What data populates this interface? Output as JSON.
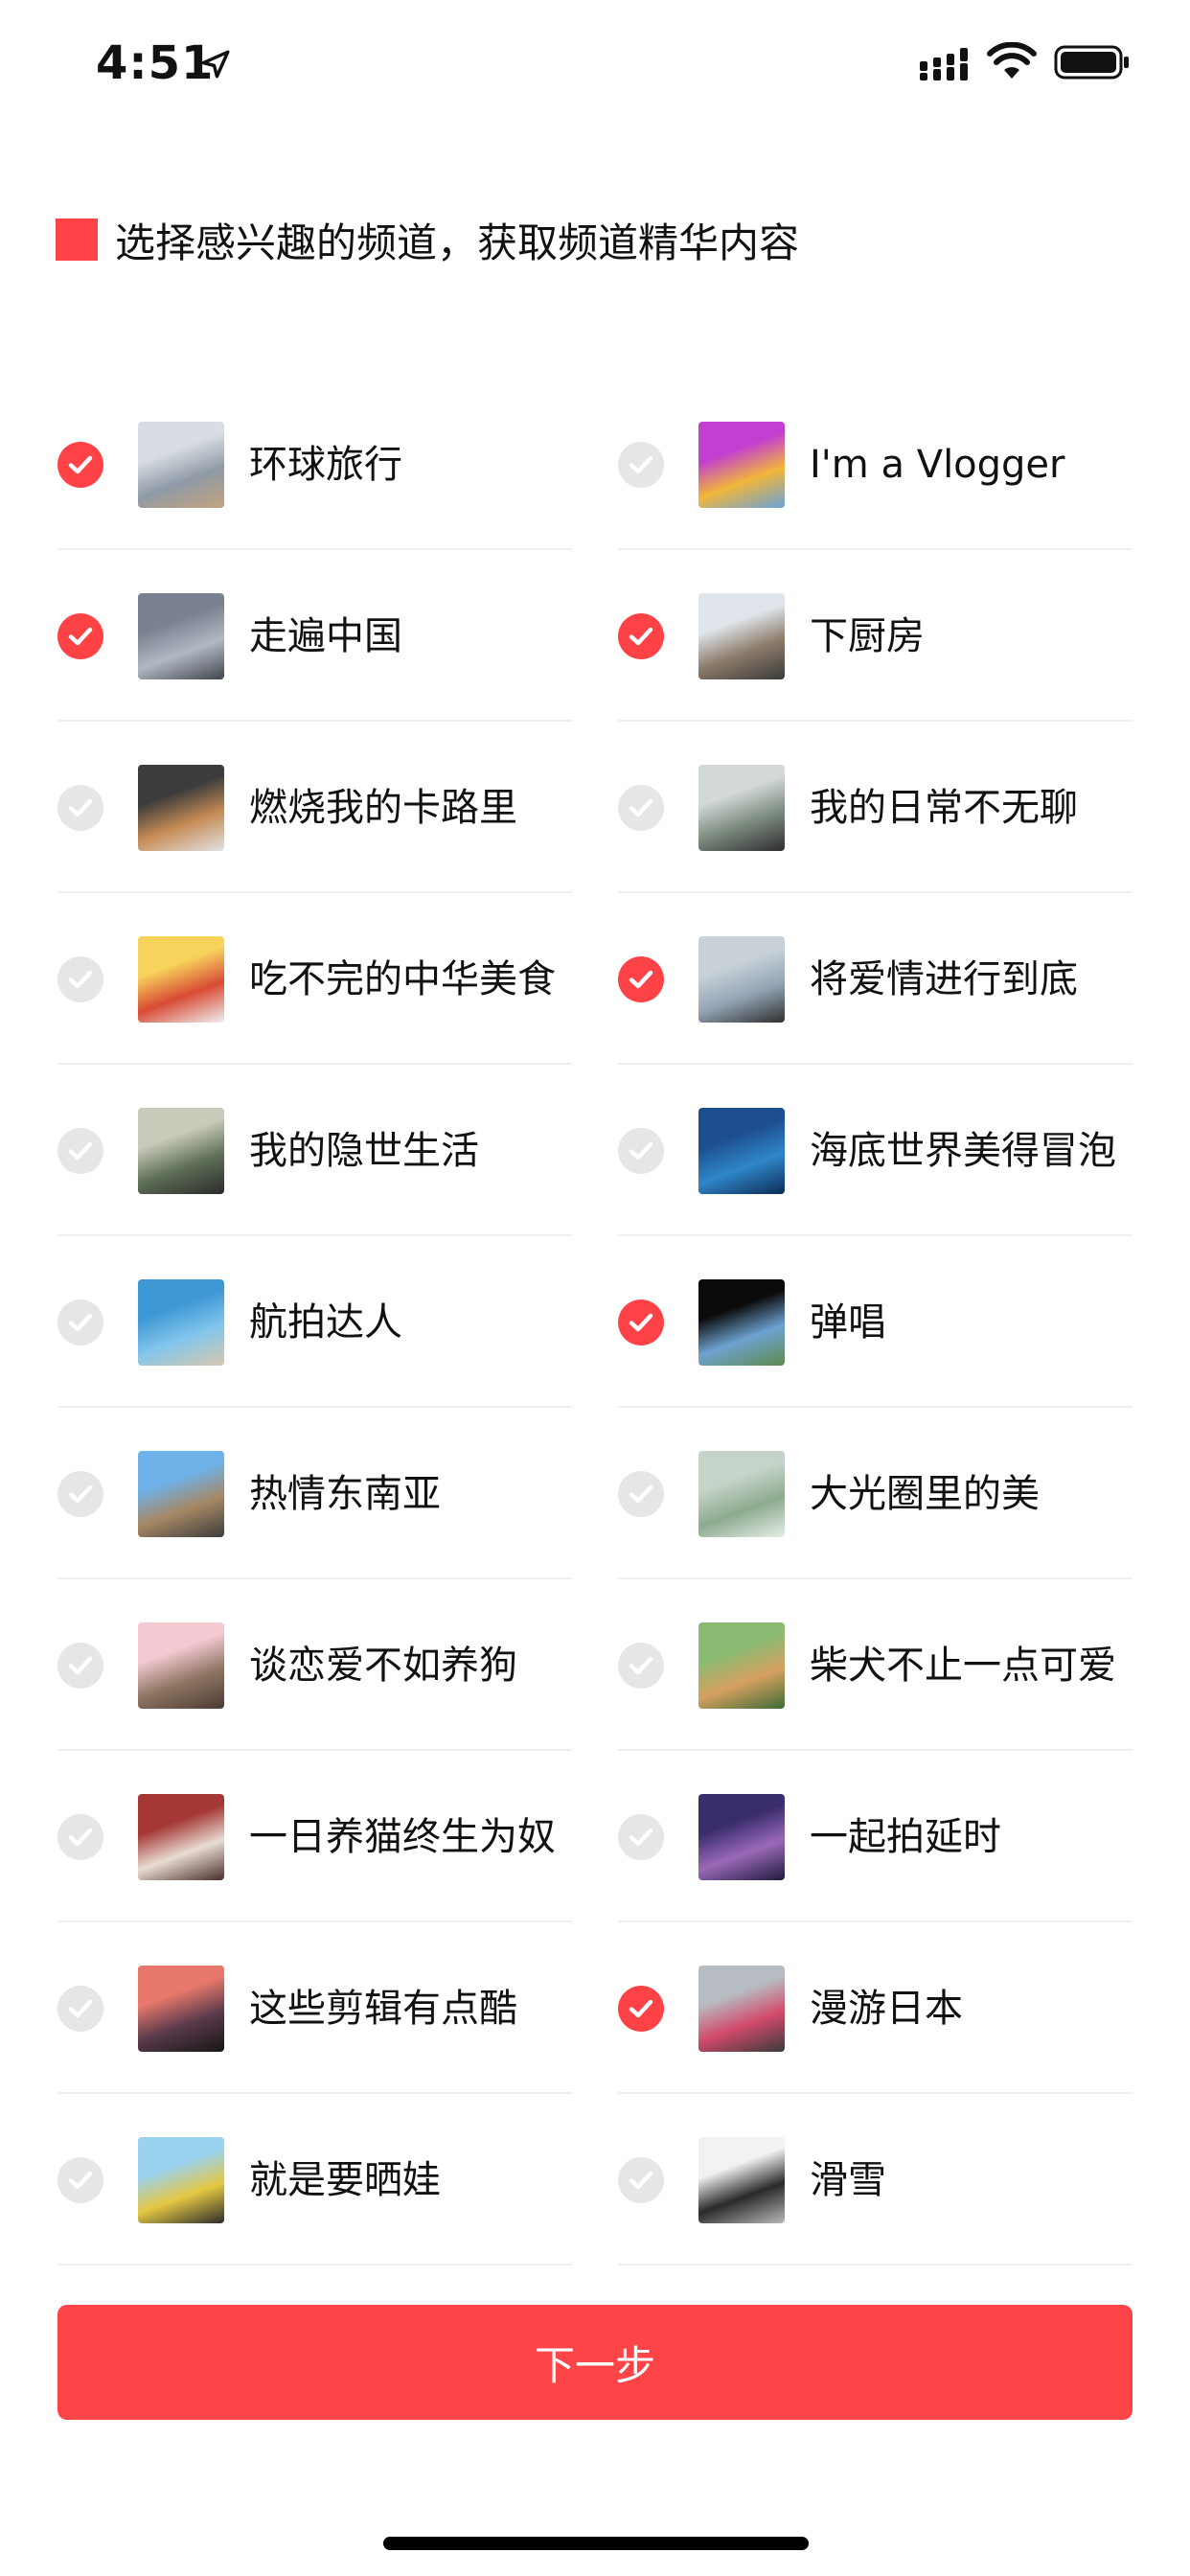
{
  "status_bar": {
    "time": "4:51"
  },
  "header": {
    "title": "选择感兴趣的频道，获取频道精华内容"
  },
  "colors": {
    "accent": "#ff4246",
    "unchecked": "#e6e6e6",
    "divider": "#efefef"
  },
  "channels": [
    {
      "label": "环球旅行",
      "checked": true,
      "thumb": [
        "#d9dde3",
        "#8f9aa6",
        "#c4a27f"
      ]
    },
    {
      "label": "I'm a Vlogger",
      "checked": false,
      "thumb": [
        "#c23fd1",
        "#f1b63a",
        "#6aa2d8"
      ]
    },
    {
      "label": "走遍中国",
      "checked": true,
      "thumb": [
        "#7a8291",
        "#b2b8c2",
        "#40444d"
      ]
    },
    {
      "label": "下厨房",
      "checked": true,
      "thumb": [
        "#dfe5ea",
        "#8c7b6a",
        "#3a3a3a"
      ]
    },
    {
      "label": "燃烧我的卡路里",
      "checked": false,
      "thumb": [
        "#3c3c3c",
        "#c58b55",
        "#e3e3e3"
      ]
    },
    {
      "label": "我的日常不无聊",
      "checked": false,
      "thumb": [
        "#d3d9d6",
        "#7c8a7e",
        "#2d2d2d"
      ]
    },
    {
      "label": "吃不完的中华美食",
      "checked": false,
      "thumb": [
        "#f7d35c",
        "#d84b35",
        "#f0f0f0"
      ]
    },
    {
      "label": "将爱情进行到底",
      "checked": true,
      "thumb": [
        "#c8d1d8",
        "#93a5b5",
        "#2f2f2f"
      ]
    },
    {
      "label": "我的隐世生活",
      "checked": false,
      "thumb": [
        "#c7cbb9",
        "#5f6f57",
        "#2a2a2a"
      ]
    },
    {
      "label": "海底世界美得冒泡",
      "checked": false,
      "thumb": [
        "#1d4f8f",
        "#2f86c9",
        "#0c2b55"
      ]
    },
    {
      "label": "航拍达人",
      "checked": false,
      "thumb": [
        "#3f98d6",
        "#83c6ec",
        "#d8c8ae"
      ]
    },
    {
      "label": "弹唱",
      "checked": true,
      "thumb": [
        "#0b0b0b",
        "#6ea2d1",
        "#5e8a4c"
      ]
    },
    {
      "label": "热情东南亚",
      "checked": false,
      "thumb": [
        "#6eb2e9",
        "#a68763",
        "#3c3c3c"
      ]
    },
    {
      "label": "大光圈里的美",
      "checked": false,
      "thumb": [
        "#c6d3c8",
        "#8cab8f",
        "#e8eee9"
      ]
    },
    {
      "label": "谈恋爱不如养狗",
      "checked": false,
      "thumb": [
        "#f4c9d2",
        "#8e7562",
        "#4b3b33"
      ]
    },
    {
      "label": "柴犬不止一点可爱",
      "checked": false,
      "thumb": [
        "#8bbb72",
        "#d6a060",
        "#3e6b35"
      ]
    },
    {
      "label": "一日养猫终生为奴",
      "checked": false,
      "thumb": [
        "#a53734",
        "#e8dcd2",
        "#4a2d2a"
      ]
    },
    {
      "label": "一起拍延时",
      "checked": false,
      "thumb": [
        "#3a2d6e",
        "#9b69b8",
        "#1e1a3d"
      ]
    },
    {
      "label": "这些剪辑有点酷",
      "checked": false,
      "thumb": [
        "#e8786c",
        "#5a3a4b",
        "#161616"
      ]
    },
    {
      "label": "漫游日本",
      "checked": true,
      "thumb": [
        "#b7bcc2",
        "#d24a6b",
        "#3a3a3a"
      ]
    },
    {
      "label": "就是要晒娃",
      "checked": false,
      "thumb": [
        "#9ad3f0",
        "#e4c742",
        "#2c2c2c"
      ]
    },
    {
      "label": "滑雪",
      "checked": false,
      "thumb": [
        "#f2f2f2",
        "#2a2a2a",
        "#b9b9b9"
      ]
    }
  ],
  "footer": {
    "next_label": "下一步"
  }
}
